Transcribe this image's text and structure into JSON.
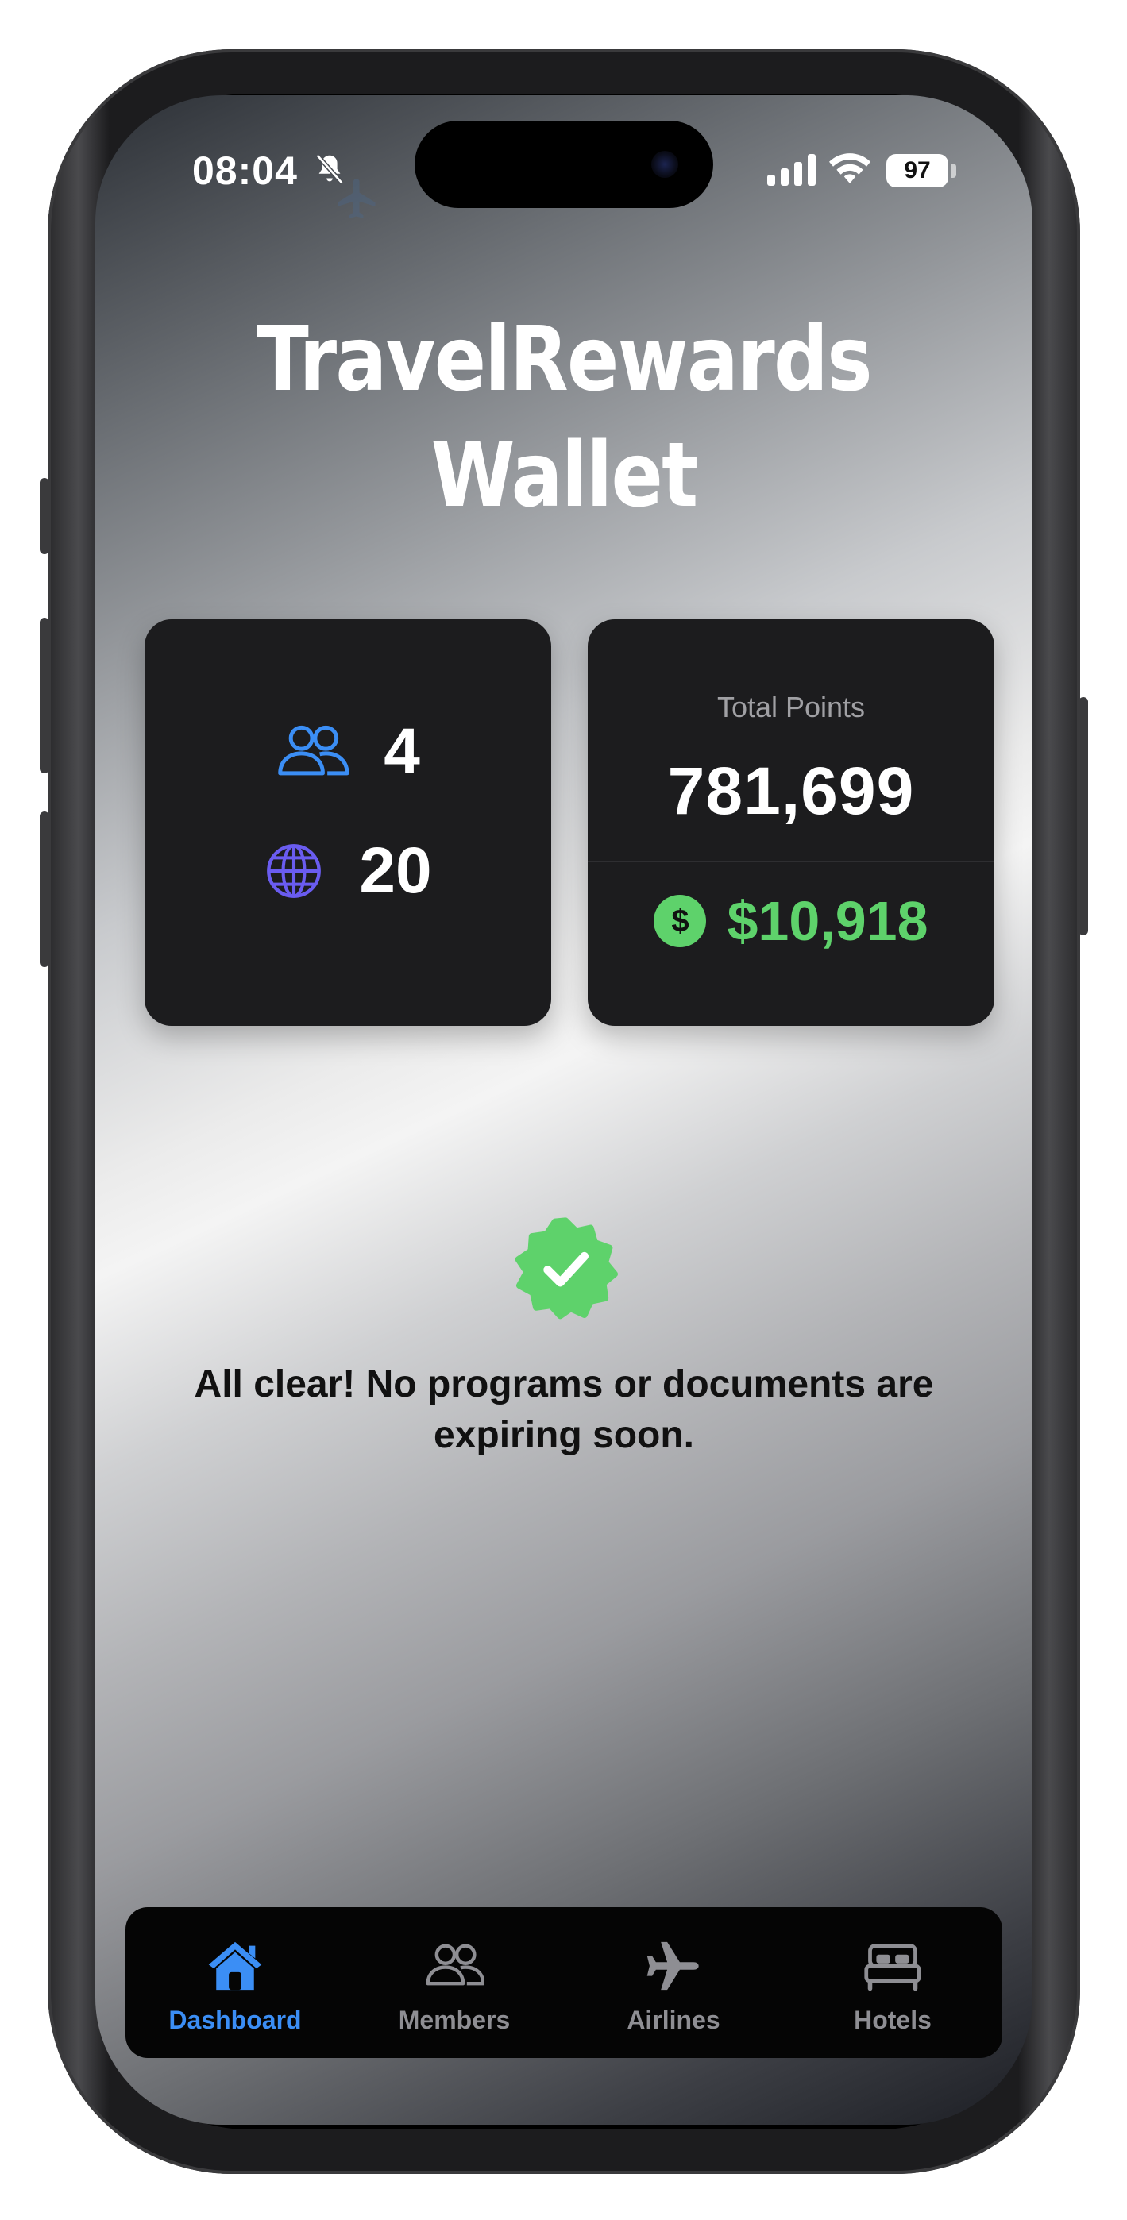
{
  "status_bar": {
    "time": "08:04",
    "battery": "97"
  },
  "header": {
    "title_line1": "TravelRewards",
    "title_line2": "Wallet"
  },
  "stats": {
    "members_count": "4",
    "countries_count": "20",
    "total_points_label": "Total Points",
    "total_points_value": "781,699",
    "cash_value": "$10,918"
  },
  "notice": {
    "message": "All clear! No programs or documents are expiring soon."
  },
  "tab_bar": {
    "tabs": [
      {
        "label": "Dashboard",
        "icon": "house-icon",
        "active": true
      },
      {
        "label": "Members",
        "icon": "people-icon",
        "active": false
      },
      {
        "label": "Airlines",
        "icon": "airplane-icon",
        "active": false
      },
      {
        "label": "Hotels",
        "icon": "bed-icon",
        "active": false
      }
    ]
  },
  "colors": {
    "accent_blue": "#3b8ef5",
    "globe_purple": "#6a5cf0",
    "cash_green": "#5ed26b",
    "card_bg": "#1c1c1e"
  }
}
